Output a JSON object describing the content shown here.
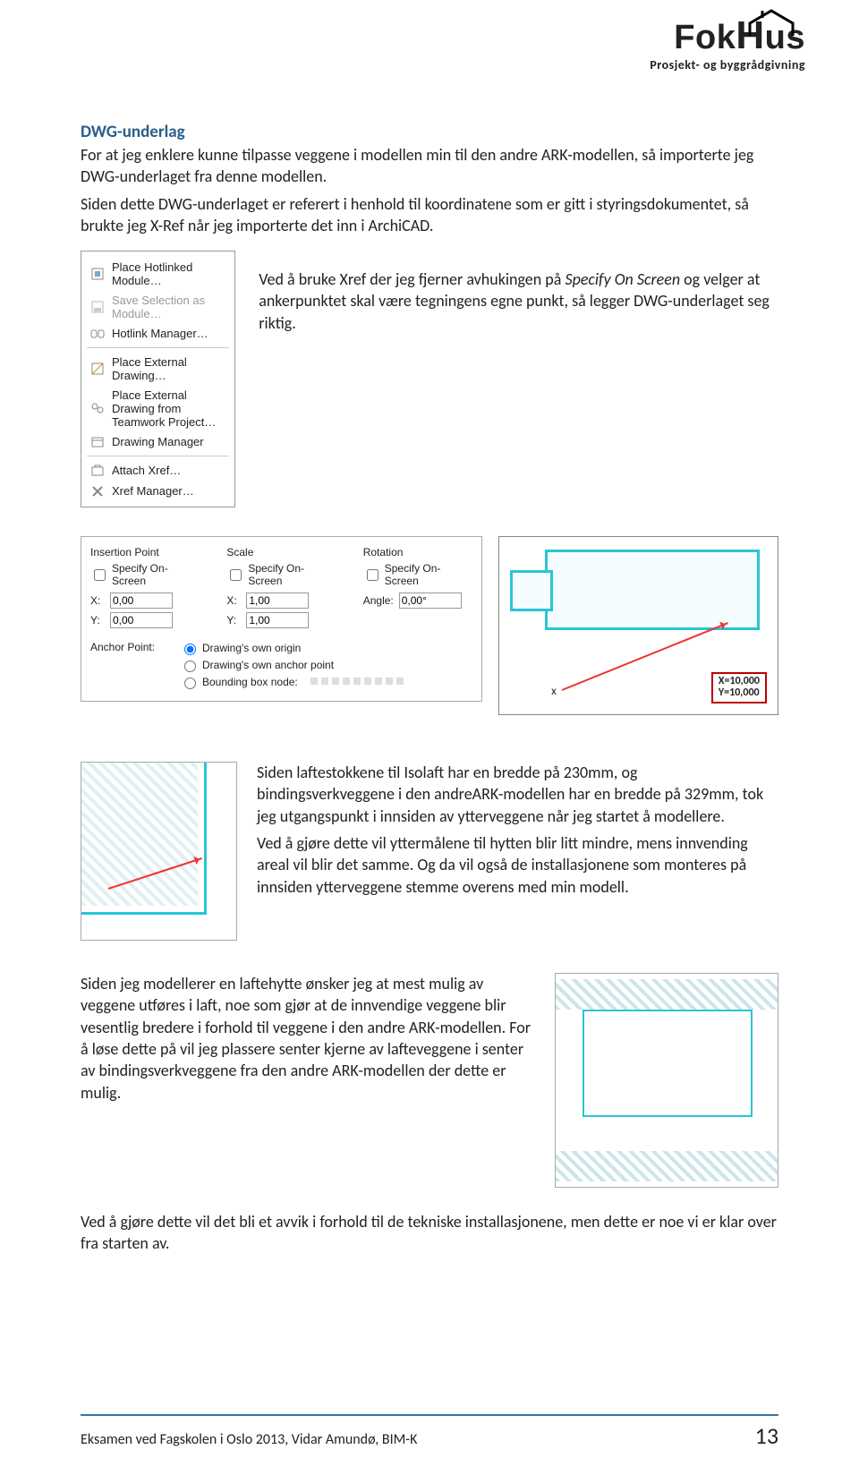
{
  "logo": {
    "brand": "FokHus",
    "tagline": "Prosjekt- og byggrådgivning"
  },
  "heading": "DWG-underlag",
  "p1": "For at jeg enklere kunne tilpasse veggene i modellen min til den andre ARK-modellen, så importerte jeg DWG-underlaget fra denne modellen.",
  "p2": "Siden dette DWG-underlaget er referert i henhold til koordinatene som er gitt i styringsdokumentet, så brukte jeg X-Ref når jeg importerte det inn i ArchiCAD.",
  "menu": {
    "items": [
      "Place Hotlinked Module…",
      "Save Selection as Module…",
      "Hotlink Manager…",
      "Place External Drawing…",
      "Place External Drawing from Teamwork Project…",
      "Drawing Manager",
      "Attach Xref…",
      "Xref Manager…"
    ]
  },
  "side1_a": "Ved å bruke Xref der jeg fjerner avhukingen på ",
  "side1_i": "Specify On Screen",
  "side1_b": " og velger at ankerpunktet skal være tegningens egne punkt, så legger DWG-underlaget seg riktig.",
  "dialog": {
    "col1_title": "Insertion Point",
    "col2_title": "Scale",
    "col3_title": "Rotation",
    "chk": "Specify On-Screen",
    "x": "X:",
    "y": "Y:",
    "angle": "Angle:",
    "val0": "0,00",
    "val1": "1,00",
    "valA": "0,00°",
    "anchor": "Anchor Point:",
    "r1": "Drawing's own origin",
    "r2": "Drawing's own anchor point",
    "r3": "Bounding box node:"
  },
  "plan_label_x": "X=10,000",
  "plan_label_y": "Y=10,000",
  "plan_x": "x",
  "p3": "Siden laftestokkene til Isolaft har en bredde på 230mm, og bindingsverkveggene i den andreARK-modellen har en bredde på 329mm, tok jeg utgangspunkt i innsiden av ytterveggene når jeg startet å modellere.",
  "p4": "Ved å gjøre dette vil yttermålene til hytten blir litt mindre, mens innvending areal vil blir det samme. Og da vil også de installasjonene som monteres på innsiden ytterveggene stemme overens med min modell.",
  "p5": "Siden jeg modellerer en laftehytte ønsker jeg at mest mulig av veggene utføres i laft, noe som gjør at de innvendige veggene blir vesentlig bredere i forhold til veggene i den andre ARK-modellen. For å løse dette på vil jeg plassere senter kjerne av lafteveggene i senter av bindingsverkveggene fra den andre ARK-modellen der dette er mulig.",
  "p6": "Ved å gjøre dette vil det bli et avvik i forhold til de tekniske installasjonene, men dette er noe vi er klar over fra starten av.",
  "footer_text": "Eksamen ved Fagskolen i Oslo 2013, Vidar Amundø, BIM-K",
  "footer_page": "13"
}
